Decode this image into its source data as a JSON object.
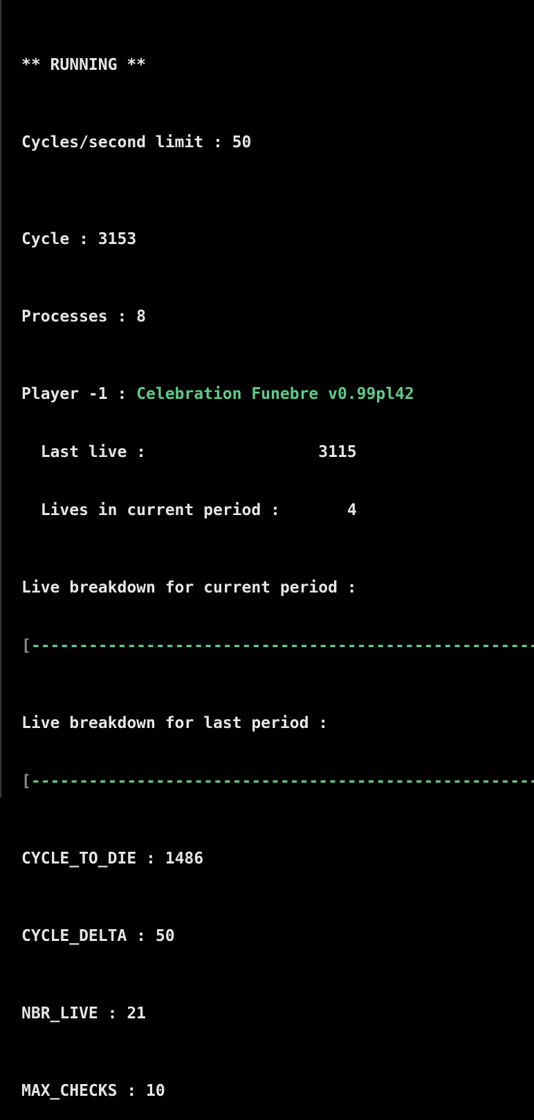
{
  "status": "** RUNNING **",
  "cycles_limit": {
    "label": "Cycles/second limit : ",
    "value": "50"
  },
  "cycle": {
    "label": "Cycle : ",
    "value": "3153"
  },
  "processes": {
    "label": "Processes : ",
    "value": "8"
  },
  "player": {
    "label": "Player -1 : ",
    "name": "Celebration Funebre v0.99pl42",
    "last_live_label": "  Last live :",
    "last_live_value": "3115",
    "lives_label": "  Lives in current period :",
    "lives_value": "4"
  },
  "breakdown_current": {
    "label": "Live breakdown for current period :",
    "bar_open": "[",
    "bar_fill": "-----------------------------------------------------",
    "bar_close": "]"
  },
  "breakdown_last": {
    "label": "Live breakdown for last period :",
    "bar_open": "[",
    "bar_fill": "-----------------------------------------------------",
    "bar_close": "]"
  },
  "cycle_to_die": {
    "label": "CYCLE_TO_DIE : ",
    "value": "1486"
  },
  "cycle_delta": {
    "label": "CYCLE_DELTA : ",
    "value": "50"
  },
  "nbr_live": {
    "label": "NBR_LIVE : ",
    "value": "21"
  },
  "max_checks": {
    "label": "MAX_CHECKS : ",
    "value": "10"
  },
  "colors": {
    "background": "#000000",
    "text": "#e6e6e6",
    "accent_green": "#5ccd8a",
    "bracket_gray": "#8a8a8a"
  }
}
